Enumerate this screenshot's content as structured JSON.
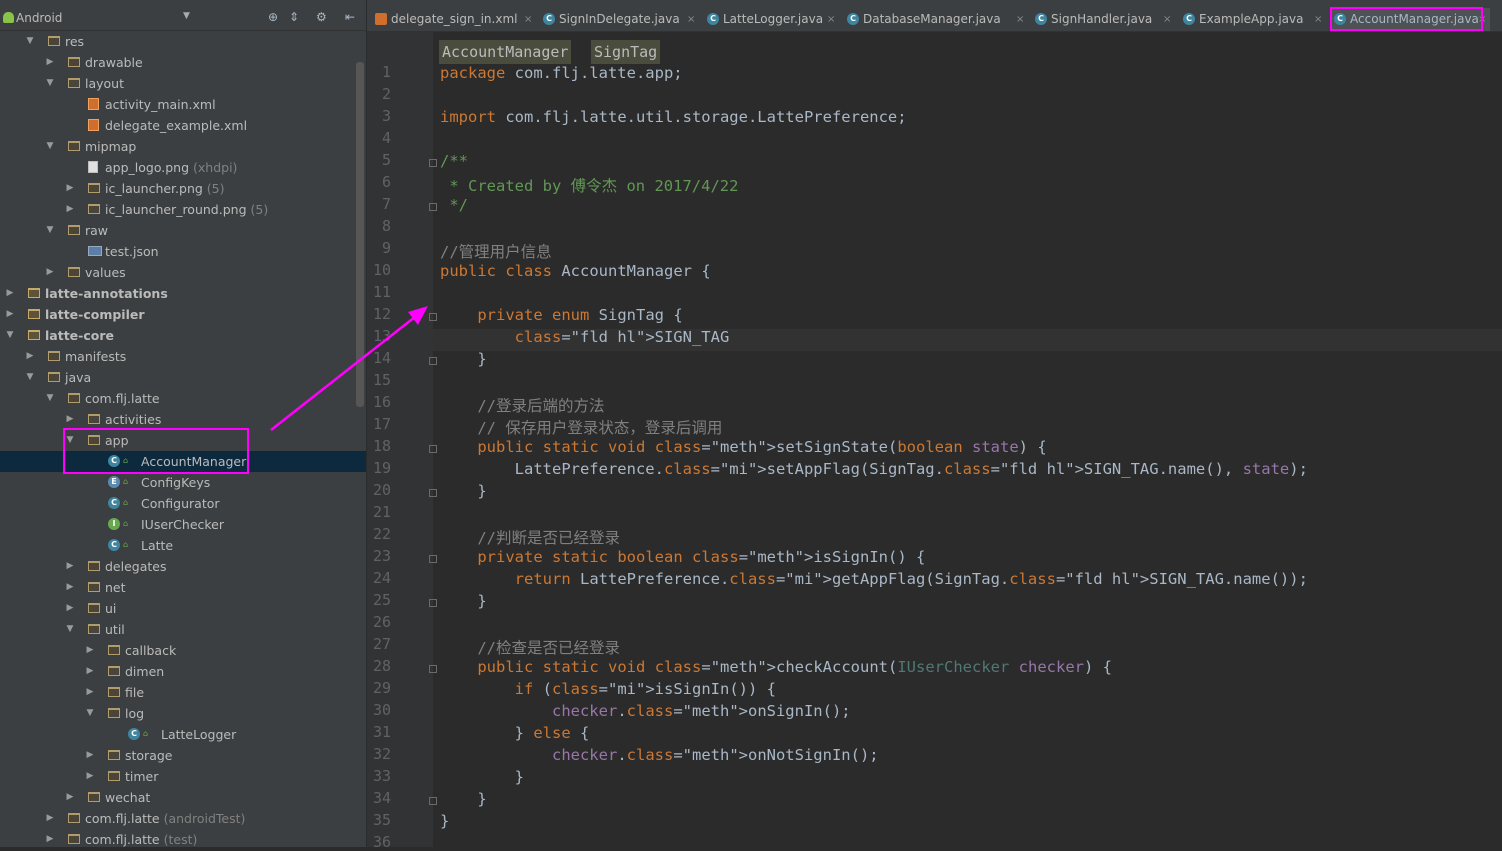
{
  "project_panel": {
    "view_mode": "Android",
    "tree": [
      {
        "label": "res",
        "depth": 1,
        "arrow": "down",
        "kind": "folder"
      },
      {
        "label": "drawable",
        "depth": 2,
        "arrow": "right",
        "kind": "folder"
      },
      {
        "label": "layout",
        "depth": 2,
        "arrow": "down",
        "kind": "folder"
      },
      {
        "label": "activity_main.xml",
        "depth": 3,
        "kind": "xml"
      },
      {
        "label": "delegate_example.xml",
        "depth": 3,
        "kind": "xml"
      },
      {
        "label": "mipmap",
        "depth": 2,
        "arrow": "down",
        "kind": "folder"
      },
      {
        "label": "app_logo.png",
        "suffix": "(xhdpi)",
        "depth": 3,
        "kind": "file"
      },
      {
        "label": "ic_launcher.png",
        "suffix": "(5)",
        "depth": 3,
        "arrow": "right",
        "kind": "folder"
      },
      {
        "label": "ic_launcher_round.png",
        "suffix": "(5)",
        "depth": 3,
        "arrow": "right",
        "kind": "folder"
      },
      {
        "label": "raw",
        "depth": 2,
        "arrow": "down",
        "kind": "folder"
      },
      {
        "label": "test.json",
        "depth": 3,
        "kind": "json"
      },
      {
        "label": "values",
        "depth": 2,
        "arrow": "right",
        "kind": "folder"
      },
      {
        "label": "latte-annotations",
        "depth": 0,
        "arrow": "right",
        "kind": "module",
        "bold": true
      },
      {
        "label": "latte-compiler",
        "depth": 0,
        "arrow": "right",
        "kind": "module",
        "bold": true
      },
      {
        "label": "latte-core",
        "depth": 0,
        "arrow": "down",
        "kind": "module",
        "bold": true
      },
      {
        "label": "manifests",
        "depth": 1,
        "arrow": "right",
        "kind": "folder"
      },
      {
        "label": "java",
        "depth": 1,
        "arrow": "down",
        "kind": "folder"
      },
      {
        "label": "com.flj.latte",
        "depth": 2,
        "arrow": "down",
        "kind": "folder"
      },
      {
        "label": "activities",
        "depth": 3,
        "arrow": "right",
        "kind": "folder"
      },
      {
        "label": "app",
        "depth": 3,
        "arrow": "down",
        "kind": "folder"
      },
      {
        "label": "AccountManager",
        "depth": 4,
        "kind": "class",
        "badge": "C",
        "selected": true
      },
      {
        "label": "ConfigKeys",
        "depth": 4,
        "kind": "class",
        "badge": "E"
      },
      {
        "label": "Configurator",
        "depth": 4,
        "kind": "class",
        "badge": "C"
      },
      {
        "label": "IUserChecker",
        "depth": 4,
        "kind": "class",
        "badge": "I"
      },
      {
        "label": "Latte",
        "depth": 4,
        "kind": "class",
        "badge": "C"
      },
      {
        "label": "delegates",
        "depth": 3,
        "arrow": "right",
        "kind": "folder"
      },
      {
        "label": "net",
        "depth": 3,
        "arrow": "right",
        "kind": "folder"
      },
      {
        "label": "ui",
        "depth": 3,
        "arrow": "right",
        "kind": "folder"
      },
      {
        "label": "util",
        "depth": 3,
        "arrow": "down",
        "kind": "folder"
      },
      {
        "label": "callback",
        "depth": 4,
        "arrow": "right",
        "kind": "folder"
      },
      {
        "label": "dimen",
        "depth": 4,
        "arrow": "right",
        "kind": "folder"
      },
      {
        "label": "file",
        "depth": 4,
        "arrow": "right",
        "kind": "folder"
      },
      {
        "label": "log",
        "depth": 4,
        "arrow": "down",
        "kind": "folder"
      },
      {
        "label": "LatteLogger",
        "depth": 5,
        "kind": "class",
        "badge": "C"
      },
      {
        "label": "storage",
        "depth": 4,
        "arrow": "right",
        "kind": "folder"
      },
      {
        "label": "timer",
        "depth": 4,
        "arrow": "right",
        "kind": "folder"
      },
      {
        "label": "wechat",
        "depth": 3,
        "arrow": "right",
        "kind": "folder"
      },
      {
        "label": "com.flj.latte",
        "suffix": "(androidTest)",
        "depth": 2,
        "arrow": "right",
        "kind": "folder"
      },
      {
        "label": "com.flj.latte",
        "suffix": "(test)",
        "depth": 2,
        "arrow": "right",
        "kind": "folder"
      }
    ]
  },
  "tabs": [
    {
      "label": "delegate_sign_in.xml",
      "icon": "xml"
    },
    {
      "label": "SignInDelegate.java",
      "icon": "class"
    },
    {
      "label": "LatteLogger.java",
      "icon": "class"
    },
    {
      "label": "DatabaseManager.java",
      "icon": "class"
    },
    {
      "label": "SignHandler.java",
      "icon": "class"
    },
    {
      "label": "ExampleApp.java",
      "icon": "class"
    },
    {
      "label": "AccountManager.java",
      "icon": "class",
      "active": true
    }
  ],
  "breadcrumb": [
    "AccountManager",
    "SignTag"
  ],
  "code_lines": [
    "package com.flj.latte.app;",
    "",
    "import com.flj.latte.util.storage.LattePreference;",
    "",
    "/**",
    " * Created by 傅令杰 on 2017/4/22",
    " */",
    "",
    "//管理用户信息",
    "public class AccountManager {",
    "",
    "    private enum SignTag {",
    "        SIGN_TAG",
    "    }",
    "",
    "    //登录后端的方法",
    "    // 保存用户登录状态，登录后调用",
    "    public static void setSignState(boolean state) {",
    "        LattePreference.setAppFlag(SignTag.SIGN_TAG.name(), state);",
    "    }",
    "",
    "    //判断是否已经登录",
    "    private static boolean isSignIn() {",
    "        return LattePreference.getAppFlag(SignTag.SIGN_TAG.name());",
    "    }",
    "",
    "    //检查是否已经登录",
    "    public static void checkAccount(IUserChecker checker) {",
    "        if (isSignIn()) {",
    "            checker.onSignIn();",
    "        } else {",
    "            checker.onNotSignIn();",
    "        }",
    "    }",
    "}",
    ""
  ],
  "line_numbers": [
    "1",
    "2",
    "3",
    "4",
    "5",
    "6",
    "7",
    "8",
    "9",
    "10",
    "11",
    "12",
    "13",
    "14",
    "15",
    "16",
    "17",
    "18",
    "19",
    "20",
    "21",
    "22",
    "23",
    "24",
    "25",
    "26",
    "27",
    "28",
    "29",
    "30",
    "31",
    "32",
    "33",
    "34",
    "35",
    "36"
  ],
  "colors": {
    "annotation": "#ff00ff",
    "keyword": "#cc7832",
    "comment": "#808080",
    "doc_comment": "#629755",
    "field": "#9876aa",
    "method": "#ffc66d",
    "background": "#2b2b2b",
    "panel": "#3c3f41",
    "selection": "#0d293e"
  }
}
